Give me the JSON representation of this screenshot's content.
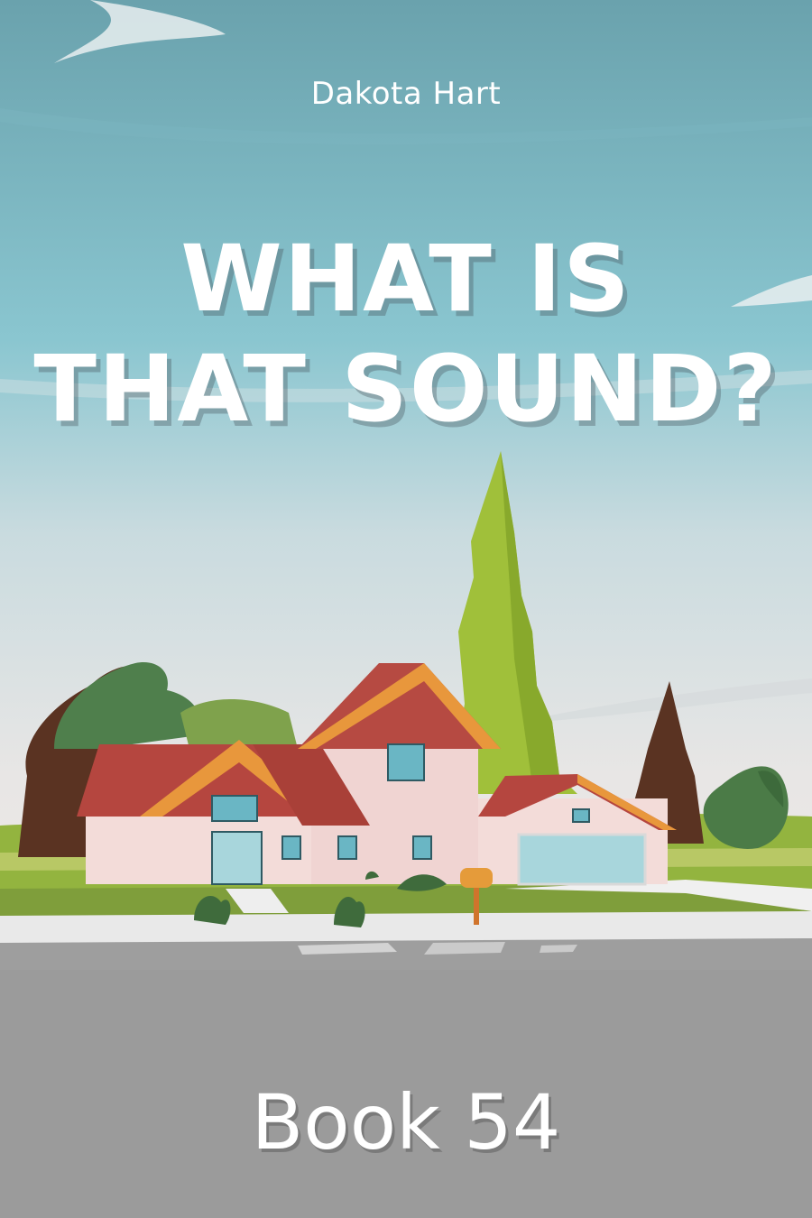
{
  "cover": {
    "author": "Dakota Hart",
    "title_line_1": "WHAT IS",
    "title_line_2": "THAT SOUND?",
    "book_label": "Book 54"
  },
  "colors": {
    "sky_top": "#6fa9b4",
    "sky_mid": "#8cc5cf",
    "sky_low": "#dfe3e3",
    "grass": "#8cae3b",
    "roof": "#b94a47",
    "walls": "#f2d8d6",
    "road": "#9b9b9b",
    "text": "#ffffff"
  }
}
